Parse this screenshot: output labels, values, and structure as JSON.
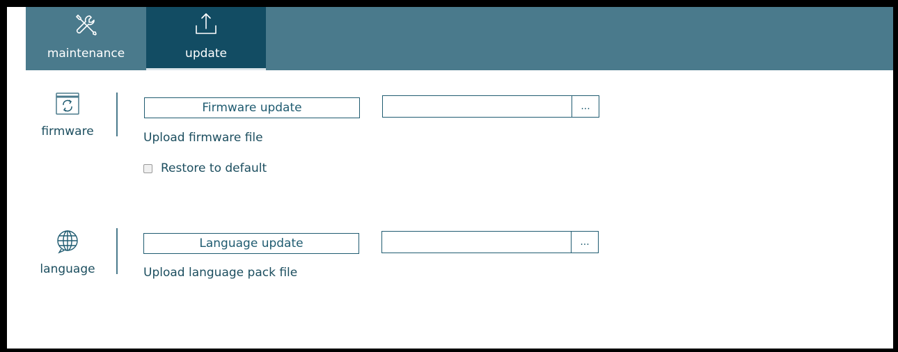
{
  "tabs": [
    {
      "label": "maintenance",
      "icon": "tools-icon",
      "active": false
    },
    {
      "label": "update",
      "icon": "upload-icon",
      "active": true
    }
  ],
  "firmware": {
    "section_label": "firmware",
    "icon": "firmware-refresh-icon",
    "button_label": "Firmware update",
    "file_value": "",
    "browse_label": "...",
    "hint": "Upload firmware file",
    "restore_label": "Restore to default",
    "restore_checked": false
  },
  "language": {
    "section_label": "language",
    "icon": "globe-icon",
    "button_label": "Language update",
    "file_value": "",
    "browse_label": "...",
    "hint": "Upload language pack file"
  },
  "colors": {
    "topbar": "#4a7a8c",
    "active_tab": "#124c63",
    "text": "#1c4e5f"
  }
}
